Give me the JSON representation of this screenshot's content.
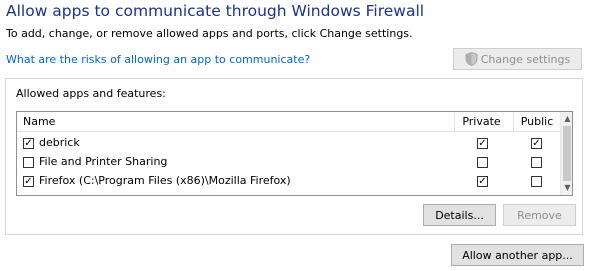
{
  "header": {
    "title": "Allow apps to communicate through Windows Firewall",
    "subtitle": "To add, change, or remove allowed apps and ports, click Change settings.",
    "risk_link": "What are the risks of allowing an app to communicate?",
    "change_settings_label": "Change settings"
  },
  "group": {
    "label": "Allowed apps and features:",
    "columns": {
      "name": "Name",
      "private": "Private",
      "public": "Public"
    },
    "rows": [
      {
        "name": "debrick",
        "enabled": true,
        "private": true,
        "public": true
      },
      {
        "name": "File and Printer Sharing",
        "enabled": false,
        "private": false,
        "public": false
      },
      {
        "name": "Firefox (C:\\Program Files (x86)\\Mozilla Firefox)",
        "enabled": true,
        "private": true,
        "public": false
      }
    ],
    "details_label": "Details...",
    "remove_label": "Remove"
  },
  "footer": {
    "allow_another_label": "Allow another app..."
  },
  "colors": {
    "title": "#1e3287",
    "link": "#0066cc",
    "button_face": "#e1e1e1",
    "disabled_text": "#8e8e8e"
  },
  "icons": {
    "change_settings": "uac-shield-icon",
    "scroll_up": "chevron-up-icon",
    "scroll_down": "chevron-down-icon"
  }
}
